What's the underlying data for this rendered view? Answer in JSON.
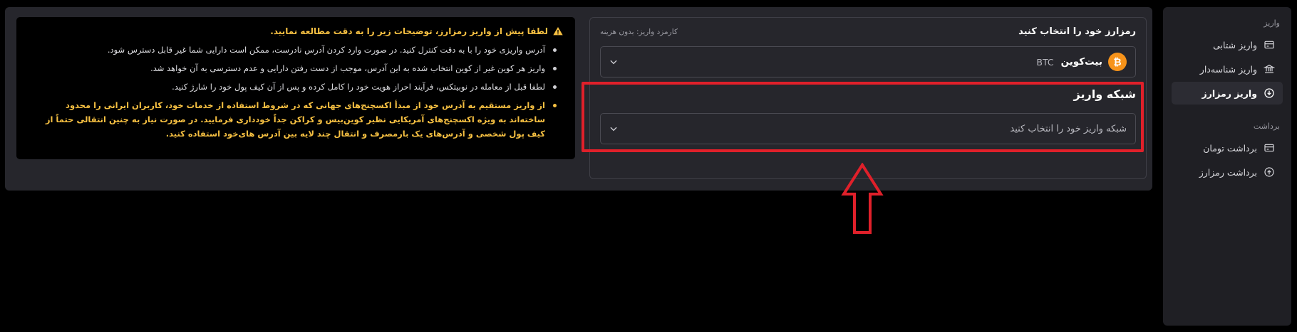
{
  "sidebar": {
    "deposit_section": "واریز",
    "deposit_items": [
      {
        "label": "واریز شتابی",
        "icon": "card-icon",
        "active": false
      },
      {
        "label": "واریز شناسه‌دار",
        "icon": "bank-icon",
        "active": false
      },
      {
        "label": "واریز رمزارز",
        "icon": "download-circle-icon",
        "active": true
      }
    ],
    "withdraw_section": "برداشت",
    "withdraw_items": [
      {
        "label": "برداشت تومان",
        "icon": "card-icon",
        "active": false
      },
      {
        "label": "برداشت رمزارز",
        "icon": "upload-circle-icon",
        "active": false
      }
    ]
  },
  "form": {
    "title": "رمزارز خود را انتخاب کنید",
    "fee_label": "کارمزد واریز: بدون هزینه",
    "selected_coin": {
      "name": "بیت‌کوین",
      "symbol": "BTC",
      "badge": "₿",
      "color": "#f7931a"
    },
    "network_title": "شبکه واریز",
    "network_placeholder": "شبکه واریز خود را انتخاب کنید"
  },
  "notice": {
    "title": "لطفا پیش از واریز رمزارز، توضیحات زیر را به دقت مطالعه نمایید.",
    "items": [
      "آدرس واریزی خود را با به دقت کنترل کنید. در صورت وارد کردن آدرس نادرست، ممکن است دارایی شما غیر قابل دسترس شود.",
      "واریز هر کوین غیر از کوین انتخاب شده به این آدرس، موجب از دست رفتن دارایی و عدم دسترسی به آن خواهد شد.",
      "لطفا قبل از معامله در نوبیتکس، فرآیند احراز هویت خود را کامل کرده و پس از آن کیف پول خود را شارژ کنید.",
      "از واریز مستقیم به آدرس خود از مبدأ اکسچنج‌های جهانی که در شروط استفاده از خدمات خود، کاربران ایرانی را محدود ساخته‌اند به ویژه اکسچنج‌های آمریکایی نظیر کوین‌بیس و کراکن جداً خودداری فرمایید. در صورت نیاز به چنین انتقالی حتماً از کیف پول شخصی و آدرس‌های یک بارمصرف و انتقال چند لایه بین آدرس های‌خود استفاده کنید."
    ]
  },
  "colors": {
    "accent_warning": "#f6c042",
    "highlight": "#e0202a",
    "bitcoin": "#f7931a"
  }
}
